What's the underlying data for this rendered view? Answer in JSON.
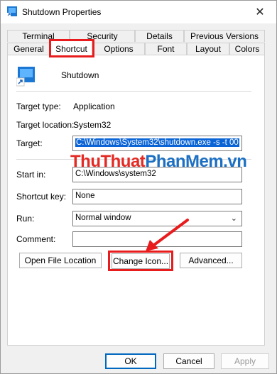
{
  "window": {
    "title": "Shutdown Properties",
    "close_glyph": "✕"
  },
  "tabs": {
    "row_top": [
      "Terminal",
      "Security",
      "Details",
      "Previous Versions"
    ],
    "row_bottom": [
      "General",
      "Shortcut",
      "Options",
      "Font",
      "Layout",
      "Colors"
    ],
    "active": "Shortcut"
  },
  "shortcut": {
    "name": "Shutdown",
    "target_type_label": "Target type:",
    "target_type": "Application",
    "target_location_label": "Target location:",
    "target_location": "System32",
    "target_label": "Target:",
    "target_value": "C:\\Windows\\System32\\shutdown.exe -s -t 00",
    "start_in_label": "Start in:",
    "start_in_value": "C:\\Windows\\system32",
    "shortcut_key_label": "Shortcut key:",
    "shortcut_key_value": "None",
    "run_label": "Run:",
    "run_value": "Normal window",
    "comment_label": "Comment:",
    "comment_value": ""
  },
  "buttons": {
    "open_file_location": "Open File Location",
    "change_icon": "Change Icon...",
    "advanced": "Advanced...",
    "ok": "OK",
    "cancel": "Cancel",
    "apply": "Apply"
  },
  "watermark": {
    "part1": "ThuThuat",
    "part2": "PhanMem",
    "part3": ".vn"
  },
  "colors": {
    "highlight": "#e81c1c",
    "selection": "#0a64d6",
    "accent": "#0067c0"
  }
}
